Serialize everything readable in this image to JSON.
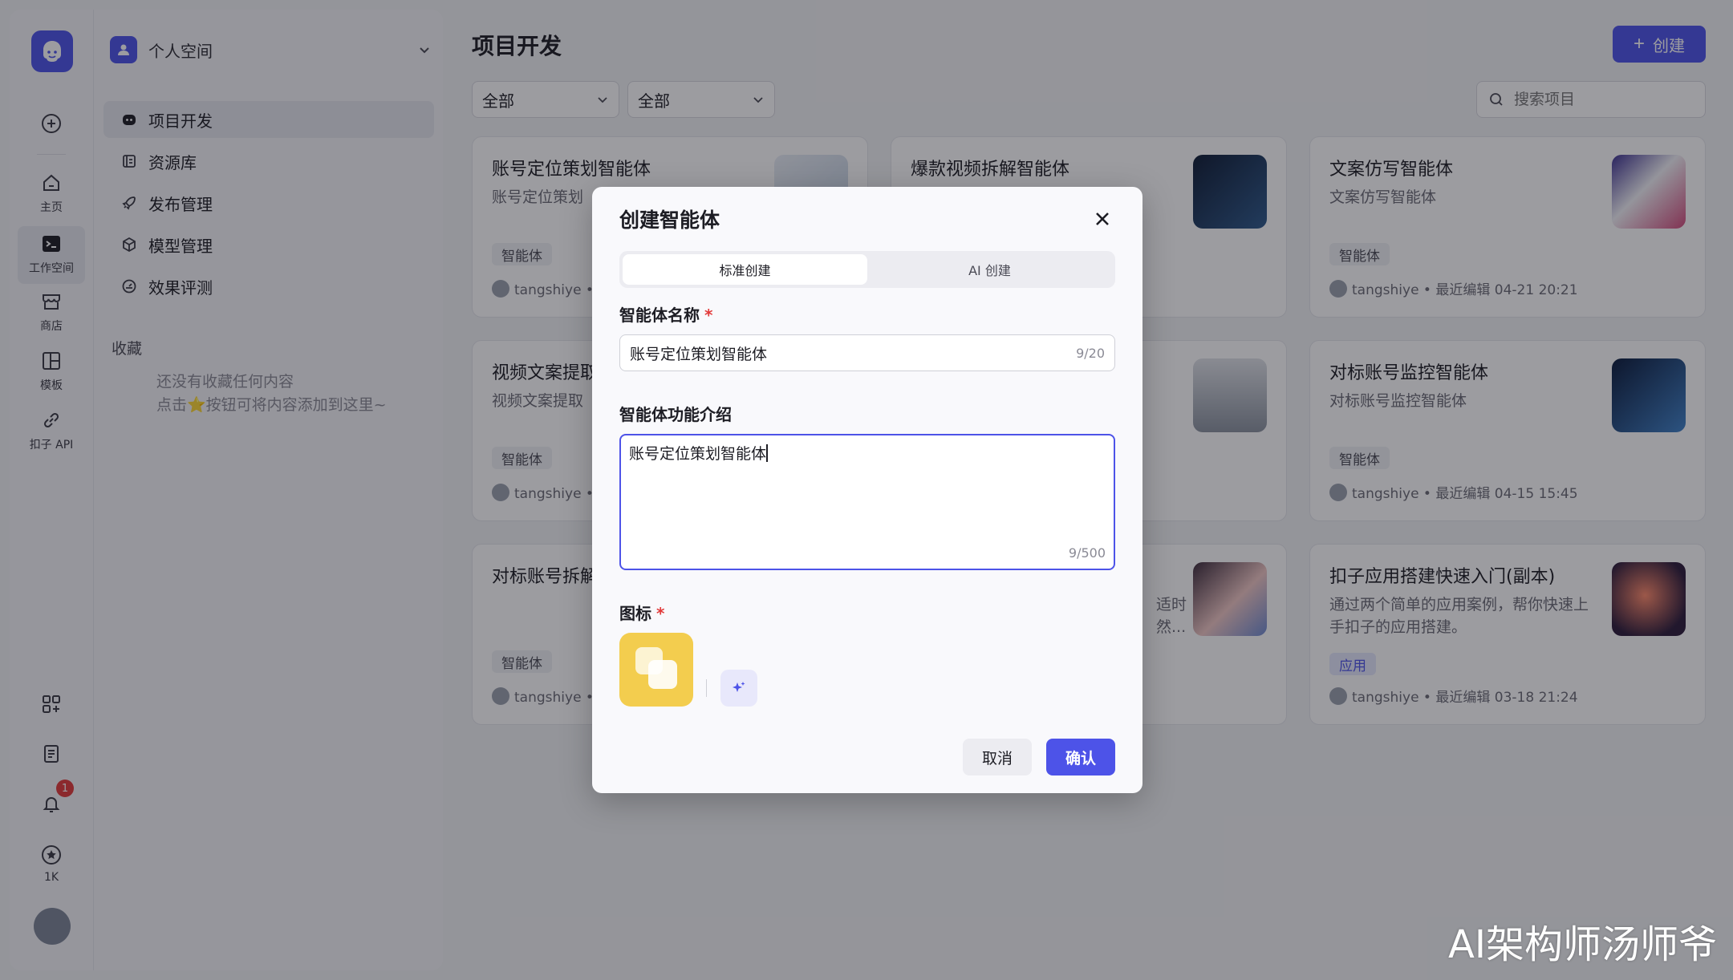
{
  "rail": {
    "items": [
      {
        "label": "主页"
      },
      {
        "label": "工作空间"
      },
      {
        "label": "商店"
      },
      {
        "label": "模板"
      },
      {
        "label": "扣子 API"
      }
    ],
    "notification_count": "1",
    "favorites_count": "1K"
  },
  "sidebar": {
    "space_name": "个人空间",
    "items": [
      {
        "label": "项目开发"
      },
      {
        "label": "资源库"
      },
      {
        "label": "发布管理"
      },
      {
        "label": "模型管理"
      },
      {
        "label": "效果评测"
      }
    ],
    "favorites_title": "收藏",
    "favorites_empty_line1": "还没有收藏任何内容",
    "favorites_empty_line2": "点击⭐按钮可将内容添加到这里~"
  },
  "main": {
    "title": "项目开发",
    "create_label": "创建",
    "filter1": "全部",
    "filter2": "全部",
    "search_placeholder": "搜索项目"
  },
  "cards": [
    {
      "title": "账号定位策划智能体",
      "desc": "账号定位策划",
      "tag": "智能体",
      "meta": "tangshiye • 最"
    },
    {
      "title": "爆款视频拆解智能体",
      "desc": "",
      "tag": "",
      "meta": ""
    },
    {
      "title": "文案仿写智能体",
      "desc": "文案仿写智能体",
      "tag": "智能体",
      "meta": "tangshiye • 最近编辑 04-21 20:21"
    },
    {
      "title": "视频文案提取",
      "desc": "视频文案提取",
      "tag": "智能体",
      "meta": "tangshiye • 最"
    },
    {
      "title": "",
      "desc": "",
      "tag": "",
      "meta": ""
    },
    {
      "title": "对标账号监控智能体",
      "desc": "对标账号监控智能体",
      "tag": "智能体",
      "meta": "tangshiye • 最近编辑 04-15 15:45"
    },
    {
      "title": "对标账号拆解",
      "desc": "",
      "tag": "智能体",
      "meta": "tangshiye • 最"
    },
    {
      "title": "",
      "desc": "适时\n然...",
      "tag": "",
      "meta": ""
    },
    {
      "title": "扣子应用搭建快速入门(副本)",
      "desc": "通过两个简单的应用案例，帮你快速上手扣子的应用搭建。",
      "tag": "应用",
      "meta": "tangshiye • 最近编辑 03-18 21:24"
    }
  ],
  "modal": {
    "title": "创建智能体",
    "tab_standard": "标准创建",
    "tab_ai": "AI 创建",
    "name_label": "智能体名称",
    "required_mark": "*",
    "name_value": "账号定位策划智能体",
    "name_count": "9/20",
    "desc_label": "智能体功能介绍",
    "desc_value": "账号定位策划智能体",
    "desc_count": "9/500",
    "icon_label": "图标",
    "cancel_label": "取消",
    "confirm_label": "确认"
  },
  "watermark": "AI架构师汤师爷",
  "colors": {
    "accent": "#4d53e8",
    "required": "#e23a3a",
    "icon_bg": "#f3cd4e"
  }
}
